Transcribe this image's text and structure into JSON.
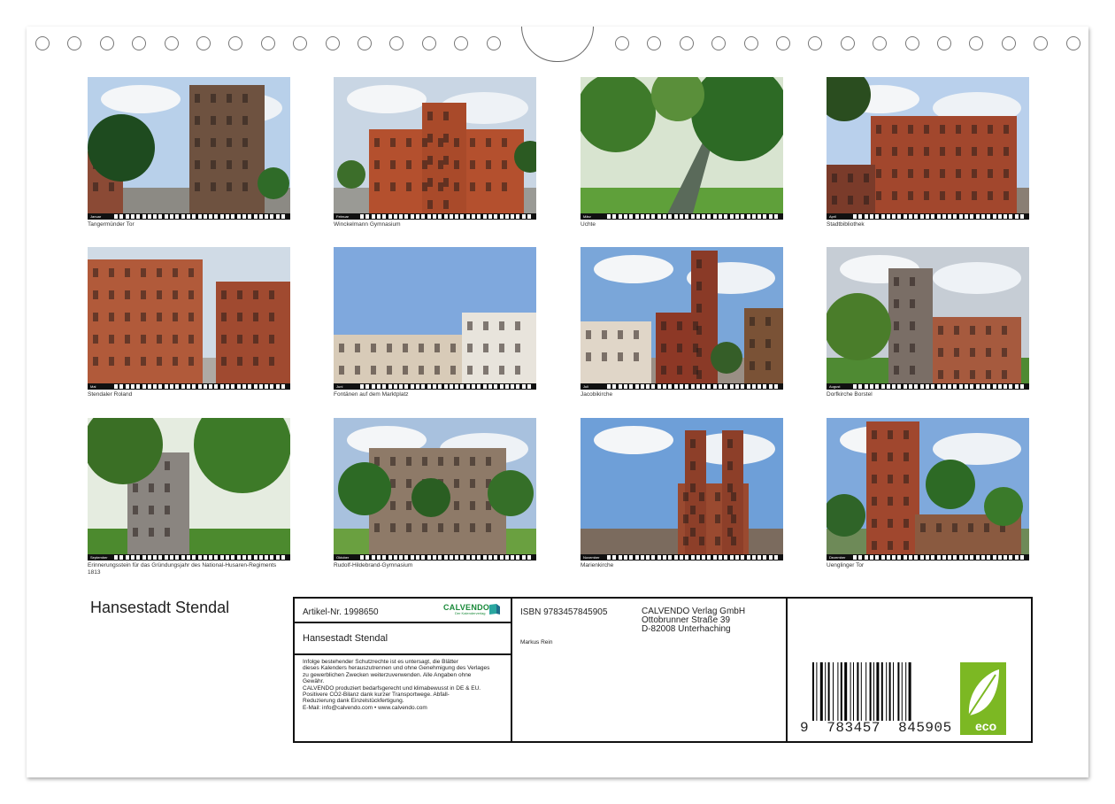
{
  "calendar_title": "Hansestadt Stendal",
  "photos": [
    {
      "caption": "Tangermünder Tor",
      "month": "Januar"
    },
    {
      "caption": "Winckelmann Gymnasium",
      "month": "Februar"
    },
    {
      "caption": "Uchte",
      "month": "März"
    },
    {
      "caption": "Stadtbibliothek",
      "month": "April"
    },
    {
      "caption": "Stendaler Roland",
      "month": "Mai"
    },
    {
      "caption": "Fontänen auf dem Marktplatz",
      "month": "Juni"
    },
    {
      "caption": "Jacobikirche",
      "month": "Juli"
    },
    {
      "caption": "Dorfkirche Borstel",
      "month": "August"
    },
    {
      "caption": "Erinnerungsstein für das Gründungsjahr des National-Husaren-Regiments 1813",
      "month": "September"
    },
    {
      "caption": "Rudolf-Hildebrand-Gymnasium",
      "month": "Oktober"
    },
    {
      "caption": "Marienkirche",
      "month": "November"
    },
    {
      "caption": "Uenglinger Tor",
      "month": "Dezember"
    }
  ],
  "info": {
    "article": "Artikel-Nr. 1998650",
    "brand": "CALVENDO",
    "brand_tagline": "Der Kalenderverlag",
    "product_title": "Hansestadt Stendal",
    "legal_lines": [
      "Infolge bestehender Schutzrechte ist es untersagt, die Blätter",
      "dieses Kalenders herauszutrennen und ohne Genehmigung des Verlages",
      "zu gewerblichen Zwecken weiterzuverwenden. Alle Angaben ohne",
      "Gewähr.",
      "CALVENDO produziert bedarfsgerecht und klimabewusst in DE & EU.",
      "Positivere CO2-Bilanz dank kurzer Transportwege. Abfall-",
      "Reduzierung dank Einzelstückfertigung.",
      "E-Mail: info@calvendo.com • www.calvendo.com"
    ],
    "isbn": "ISBN 9783457845905",
    "author": "Markus Rein",
    "publisher_lines": [
      "CALVENDO Verlag GmbH",
      "Ottobrunner Straße 39",
      "D-82008 Unterhaching"
    ],
    "barcode_text": "9  783457  845905",
    "eco_label": "eco"
  }
}
